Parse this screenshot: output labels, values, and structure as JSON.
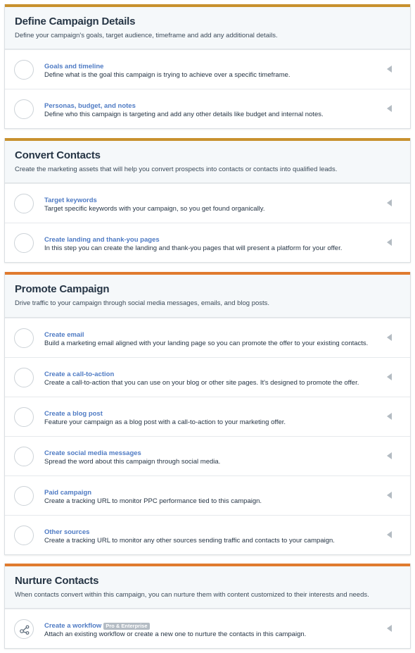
{
  "colors": {
    "bar_gold": "#c8912e",
    "bar_orange": "#e07b2f",
    "link_blue": "#4f7bc4"
  },
  "sections": [
    {
      "title": "Define Campaign Details",
      "description": "Define your campaign's goals, target audience, timeframe and add any additional details.",
      "steps": [
        {
          "title": "Goals and timeline",
          "description": "Define what is the goal this campaign is trying to achieve over a specific timeframe.",
          "icon": "empty-circle-icon"
        },
        {
          "title": "Personas, budget, and notes",
          "description": "Define who this campaign is targeting and add any other details like budget and internal notes.",
          "icon": "empty-circle-icon"
        }
      ]
    },
    {
      "title": "Convert Contacts",
      "description": "Create the marketing assets that will help you convert prospects into contacts or contacts into qualified leads.",
      "steps": [
        {
          "title": "Target keywords",
          "description": "Target specific keywords with your campaign, so you get found organically.",
          "icon": "empty-circle-icon"
        },
        {
          "title": "Create landing and thank-you pages",
          "description": "In this step you can create the landing and thank-you pages that will present a platform for your offer.",
          "icon": "empty-circle-icon"
        }
      ]
    },
    {
      "title": "Promote Campaign",
      "description": "Drive traffic to your campaign through social media messages, emails, and blog posts.",
      "steps": [
        {
          "title": "Create email",
          "description": "Build a marketing email aligned with your landing page so you can promote the offer to your existing contacts.",
          "icon": "empty-circle-icon"
        },
        {
          "title": "Create a call-to-action",
          "description": "Create a call-to-action that you can use on your blog or other site pages. It's designed to promote the offer.",
          "icon": "empty-circle-icon"
        },
        {
          "title": "Create a blog post",
          "description": "Feature your campaign as a blog post with a call-to-action to your marketing offer.",
          "icon": "empty-circle-icon"
        },
        {
          "title": "Create social media messages",
          "description": "Spread the word about this campaign through social media.",
          "icon": "empty-circle-icon"
        },
        {
          "title": "Paid campaign",
          "description": "Create a tracking URL to monitor PPC performance tied to this campaign.",
          "icon": "empty-circle-icon"
        },
        {
          "title": "Other sources",
          "description": "Create a tracking URL to monitor any other sources sending traffic and contacts to your campaign.",
          "icon": "empty-circle-icon"
        }
      ]
    },
    {
      "title": "Nurture Contacts",
      "description": "When contacts convert within this campaign, you can nurture them with content customized to their interests and needs.",
      "steps": [
        {
          "title": "Create a workflow",
          "badge": "Pro & Enterprise",
          "description": "Attach an existing workflow or create a new one to nurture the contacts in this campaign.",
          "icon": "workflow-icon"
        }
      ]
    }
  ]
}
